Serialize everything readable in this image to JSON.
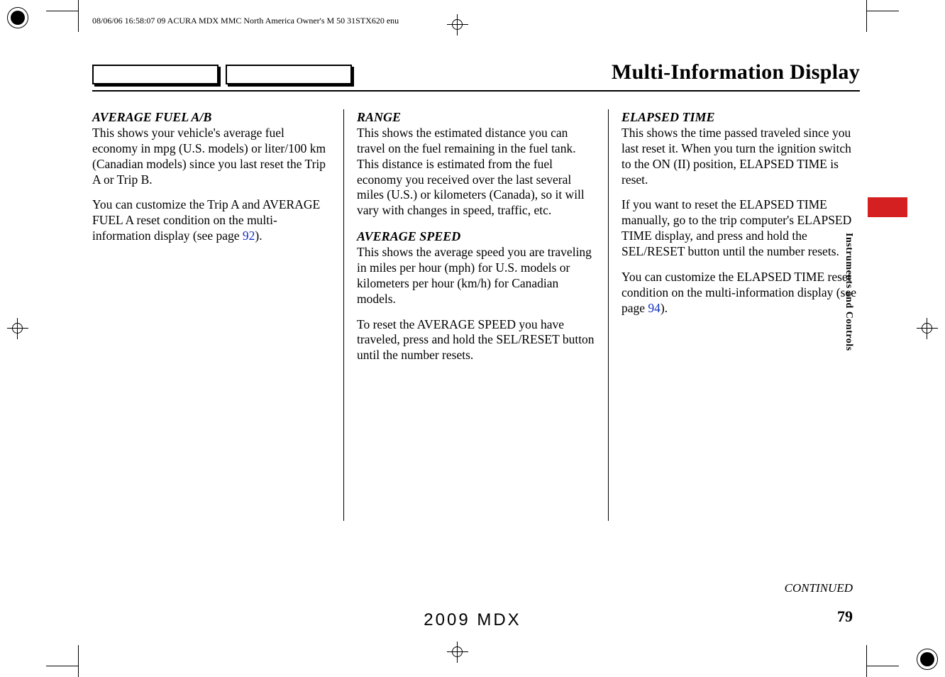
{
  "meta": {
    "header_line": "08/06/06 16:58:07   09 ACURA MDX MMC North America Owner's M 50 31STX620 enu"
  },
  "title": "Multi-Information Display",
  "sidebar_label": "Instruments and Controls",
  "continued": "CONTINUED",
  "footer_model": "2009  MDX",
  "page_number": "79",
  "col1": {
    "h1": "AVERAGE FUEL A/B",
    "p1": "This shows your vehicle's average fuel economy in mpg (U.S. models) or liter/100 km (Canadian models) since you last reset the Trip A or Trip B.",
    "p2a": "You can customize the Trip A and AVERAGE FUEL A reset condition on the multi-information display (see page ",
    "p2_ref": "92",
    "p2b": ")."
  },
  "col2": {
    "h1": "RANGE",
    "p1": "This shows the estimated distance you can travel on the fuel remaining in the fuel tank. This distance is estimated from the fuel economy you received over the last several miles (U.S.) or kilometers (Canada), so it will vary with changes in speed, traffic, etc.",
    "h2": "AVERAGE SPEED",
    "p2": "This shows the average speed you are traveling in miles per hour (mph) for U.S. models or kilometers per hour (km/h) for Canadian models.",
    "p3": "To reset the AVERAGE SPEED you have traveled, press and hold the SEL/RESET button until the number resets."
  },
  "col3": {
    "h1": "ELAPSED TIME",
    "p1": "This shows the time passed traveled since you last reset it. When you turn the ignition switch to the ON (II) position, ELAPSED TIME is reset.",
    "p2": "If you want to reset the ELAPSED TIME manually, go to the trip computer's ELAPSED TIME display, and press and hold the SEL/RESET button until the number resets.",
    "p3a": "You can customize the ELAPSED TIME reset condition on the multi-information display (see page ",
    "p3_ref": "94",
    "p3b": ")."
  }
}
